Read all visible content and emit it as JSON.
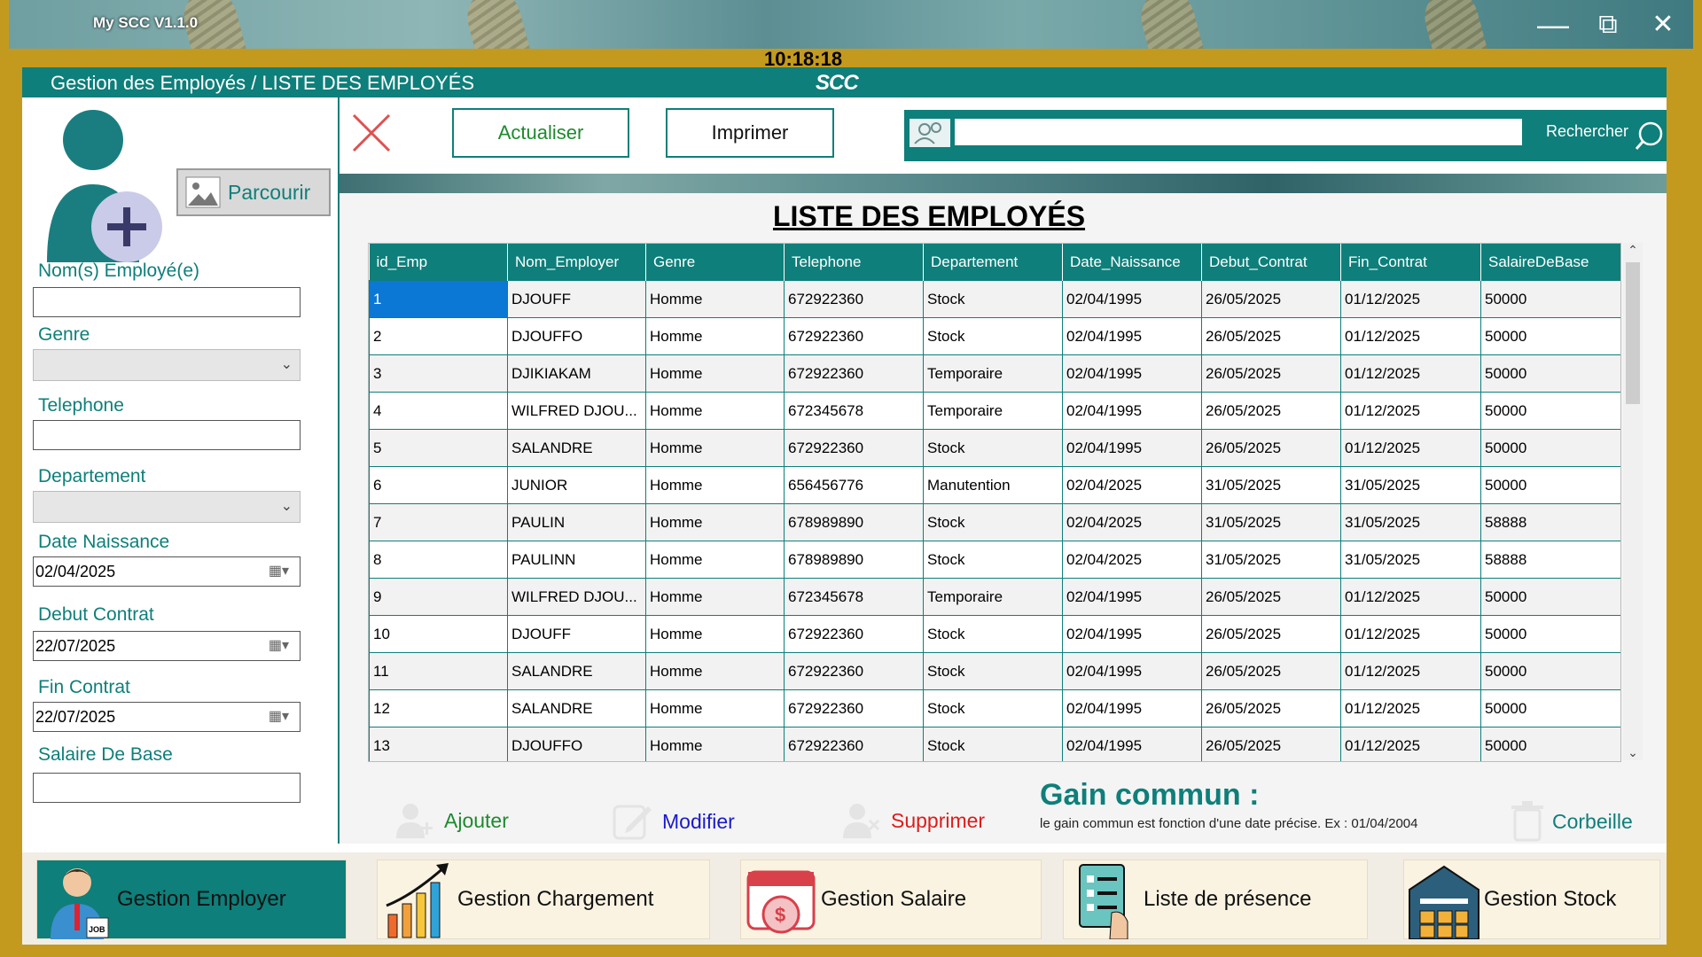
{
  "app": {
    "title": "My SCC  V1.1.0",
    "clock": "10:18:18",
    "logo": "SCC"
  },
  "window_controls": {
    "minimize": "—",
    "maximize": "⧉",
    "close": "✕"
  },
  "header": {
    "breadcrumb": "Gestion des Employés  /  LISTE DES EMPLOYÉS"
  },
  "form": {
    "browse_label": "Parcourir",
    "name_label": "Nom(s) Employé(e)",
    "name_value": "",
    "genre_label": "Genre",
    "telephone_label": "Telephone",
    "telephone_value": "",
    "departement_label": "Departement",
    "date_naissance_label": "Date Naissance",
    "date_naissance_value": "02/04/2025",
    "debut_contrat_label": "Debut Contrat",
    "debut_contrat_value": "22/07/2025",
    "fin_contrat_label": "Fin Contrat",
    "fin_contrat_value": "22/07/2025",
    "salaire_label": "Salaire De Base",
    "salaire_value": ""
  },
  "toolbar": {
    "refresh_label": "Actualiser",
    "print_label": "Imprimer",
    "search_label": "Rechercher",
    "search_value": ""
  },
  "list": {
    "title": "LISTE DES EMPLOYÉS",
    "columns": [
      "id_Emp",
      "Nom_Employer",
      "Genre",
      "Telephone",
      "Departement",
      "Date_Naissance",
      "Debut_Contrat",
      "Fin_Contrat",
      "SalaireDeBase"
    ],
    "rows": [
      [
        "1",
        "DJOUFF",
        "Homme",
        "672922360",
        "Stock",
        "02/04/1995",
        "26/05/2025",
        "01/12/2025",
        "50000"
      ],
      [
        "2",
        "DJOUFFO",
        "Homme",
        "672922360",
        "Stock",
        "02/04/1995",
        "26/05/2025",
        "01/12/2025",
        "50000"
      ],
      [
        "3",
        "DJIKIAKAM",
        "Homme",
        "672922360",
        "Temporaire",
        "02/04/1995",
        "26/05/2025",
        "01/12/2025",
        "50000"
      ],
      [
        "4",
        "WILFRED DJOU...",
        "Homme",
        "672345678",
        "Temporaire",
        "02/04/1995",
        "26/05/2025",
        "01/12/2025",
        "50000"
      ],
      [
        "5",
        "SALANDRE",
        "Homme",
        "672922360",
        "Stock",
        "02/04/1995",
        "26/05/2025",
        "01/12/2025",
        "50000"
      ],
      [
        "6",
        "JUNIOR",
        "Homme",
        "656456776",
        "Manutention",
        "02/04/2025",
        "31/05/2025",
        "31/05/2025",
        "50000"
      ],
      [
        "7",
        "PAULIN",
        "Homme",
        "678989890",
        "Stock",
        "02/04/2025",
        "31/05/2025",
        "31/05/2025",
        "58888"
      ],
      [
        "8",
        "PAULINN",
        "Homme",
        "678989890",
        "Stock",
        "02/04/2025",
        "31/05/2025",
        "31/05/2025",
        "58888"
      ],
      [
        "9",
        "WILFRED DJOU...",
        "Homme",
        "672345678",
        "Temporaire",
        "02/04/1995",
        "26/05/2025",
        "01/12/2025",
        "50000"
      ],
      [
        "10",
        "DJOUFF",
        "Homme",
        "672922360",
        "Stock",
        "02/04/1995",
        "26/05/2025",
        "01/12/2025",
        "50000"
      ],
      [
        "11",
        "SALANDRE",
        "Homme",
        "672922360",
        "Stock",
        "02/04/1995",
        "26/05/2025",
        "01/12/2025",
        "50000"
      ],
      [
        "12",
        "SALANDRE",
        "Homme",
        "672922360",
        "Stock",
        "02/04/1995",
        "26/05/2025",
        "01/12/2025",
        "50000"
      ],
      [
        "13",
        "DJOUFFO",
        "Homme",
        "672922360",
        "Stock",
        "02/04/1995",
        "26/05/2025",
        "01/12/2025",
        "50000"
      ]
    ],
    "selected_row": 0
  },
  "actions": {
    "add_label": "Ajouter",
    "edit_label": "Modifier",
    "delete_label": "Supprimer",
    "trash_label": "Corbeille",
    "gain_title": "Gain commun :",
    "gain_note": "le gain commun est fonction d'une date précise. Ex : 01/04/2004"
  },
  "bottom_nav": [
    {
      "label": "Gestion Employer",
      "icon": "employee-job-icon",
      "active": true
    },
    {
      "label": "Gestion Chargement",
      "icon": "growth-chart-icon",
      "active": false
    },
    {
      "label": "Gestion Salaire",
      "icon": "salary-calendar-icon",
      "active": false
    },
    {
      "label": "Liste de présence",
      "icon": "checklist-icon",
      "active": false
    },
    {
      "label": "Gestion Stock",
      "icon": "warehouse-icon",
      "active": false
    }
  ],
  "colors": {
    "primary": "#0e7f7a",
    "add": "#1e8a2e",
    "edit": "#1a1acc",
    "delete": "#e01b1b",
    "selection": "#0a78d4",
    "frame": "#c49a1e"
  }
}
